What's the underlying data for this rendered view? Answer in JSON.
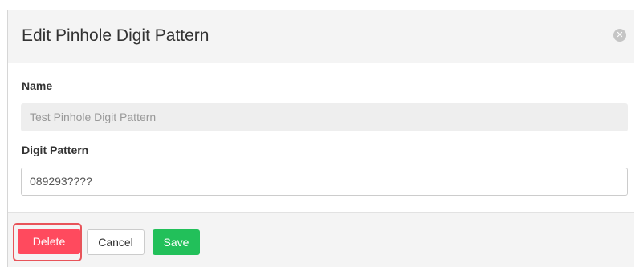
{
  "dialog": {
    "title": "Edit Pinhole Digit Pattern",
    "close_icon": "close-icon"
  },
  "form": {
    "name_label": "Name",
    "name_value": "Test Pinhole Digit Pattern",
    "digit_pattern_label": "Digit Pattern",
    "digit_pattern_value": "089293????"
  },
  "footer": {
    "delete_label": "Delete",
    "cancel_label": "Cancel",
    "save_label": "Save"
  },
  "colors": {
    "delete": "#ff4a5e",
    "save": "#22c05a",
    "highlight": "#e8545a"
  }
}
